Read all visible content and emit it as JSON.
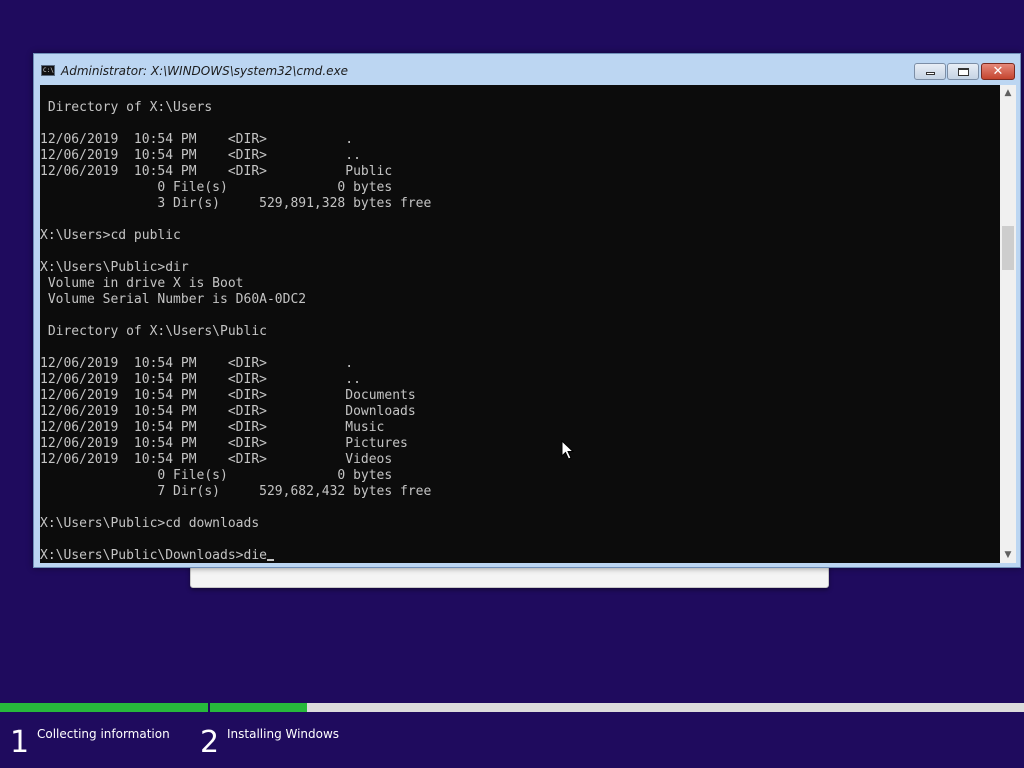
{
  "window": {
    "title": "Administrator: X:\\WINDOWS\\system32\\cmd.exe",
    "icon": "cmd-icon",
    "buttons": {
      "minimize": "minimize-icon",
      "maximize": "maximize-icon",
      "close": "close-icon"
    }
  },
  "console": {
    "lines": [
      " Directory of X:\\Users",
      "",
      "12/06/2019  10:54 PM    <DIR>          .",
      "12/06/2019  10:54 PM    <DIR>          ..",
      "12/06/2019  10:54 PM    <DIR>          Public",
      "               0 File(s)              0 bytes",
      "               3 Dir(s)     529,891,328 bytes free",
      "",
      "X:\\Users>cd public",
      "",
      "X:\\Users\\Public>dir",
      " Volume in drive X is Boot",
      " Volume Serial Number is D60A-0DC2",
      "",
      " Directory of X:\\Users\\Public",
      "",
      "12/06/2019  10:54 PM    <DIR>          .",
      "12/06/2019  10:54 PM    <DIR>          ..",
      "12/06/2019  10:54 PM    <DIR>          Documents",
      "12/06/2019  10:54 PM    <DIR>          Downloads",
      "12/06/2019  10:54 PM    <DIR>          Music",
      "12/06/2019  10:54 PM    <DIR>          Pictures",
      "12/06/2019  10:54 PM    <DIR>          Videos",
      "               0 File(s)              0 bytes",
      "               7 Dir(s)     529,682,432 bytes free",
      "",
      "X:\\Users\\Public>cd downloads",
      ""
    ],
    "prompt": "X:\\Users\\Public\\Downloads>",
    "input": "die"
  },
  "setup": {
    "progress": {
      "step1_fraction": 1.0,
      "step2_fraction": 0.12
    },
    "steps": [
      {
        "number": "1",
        "label": "Collecting information"
      },
      {
        "number": "2",
        "label": "Installing Windows"
      }
    ]
  },
  "colors": {
    "desktop": "#1f0b5e",
    "console_bg": "#0c0c0c",
    "console_fg": "#c4c4c4",
    "progress_fill": "#27b93c",
    "progress_track": "#dcdcdc"
  }
}
